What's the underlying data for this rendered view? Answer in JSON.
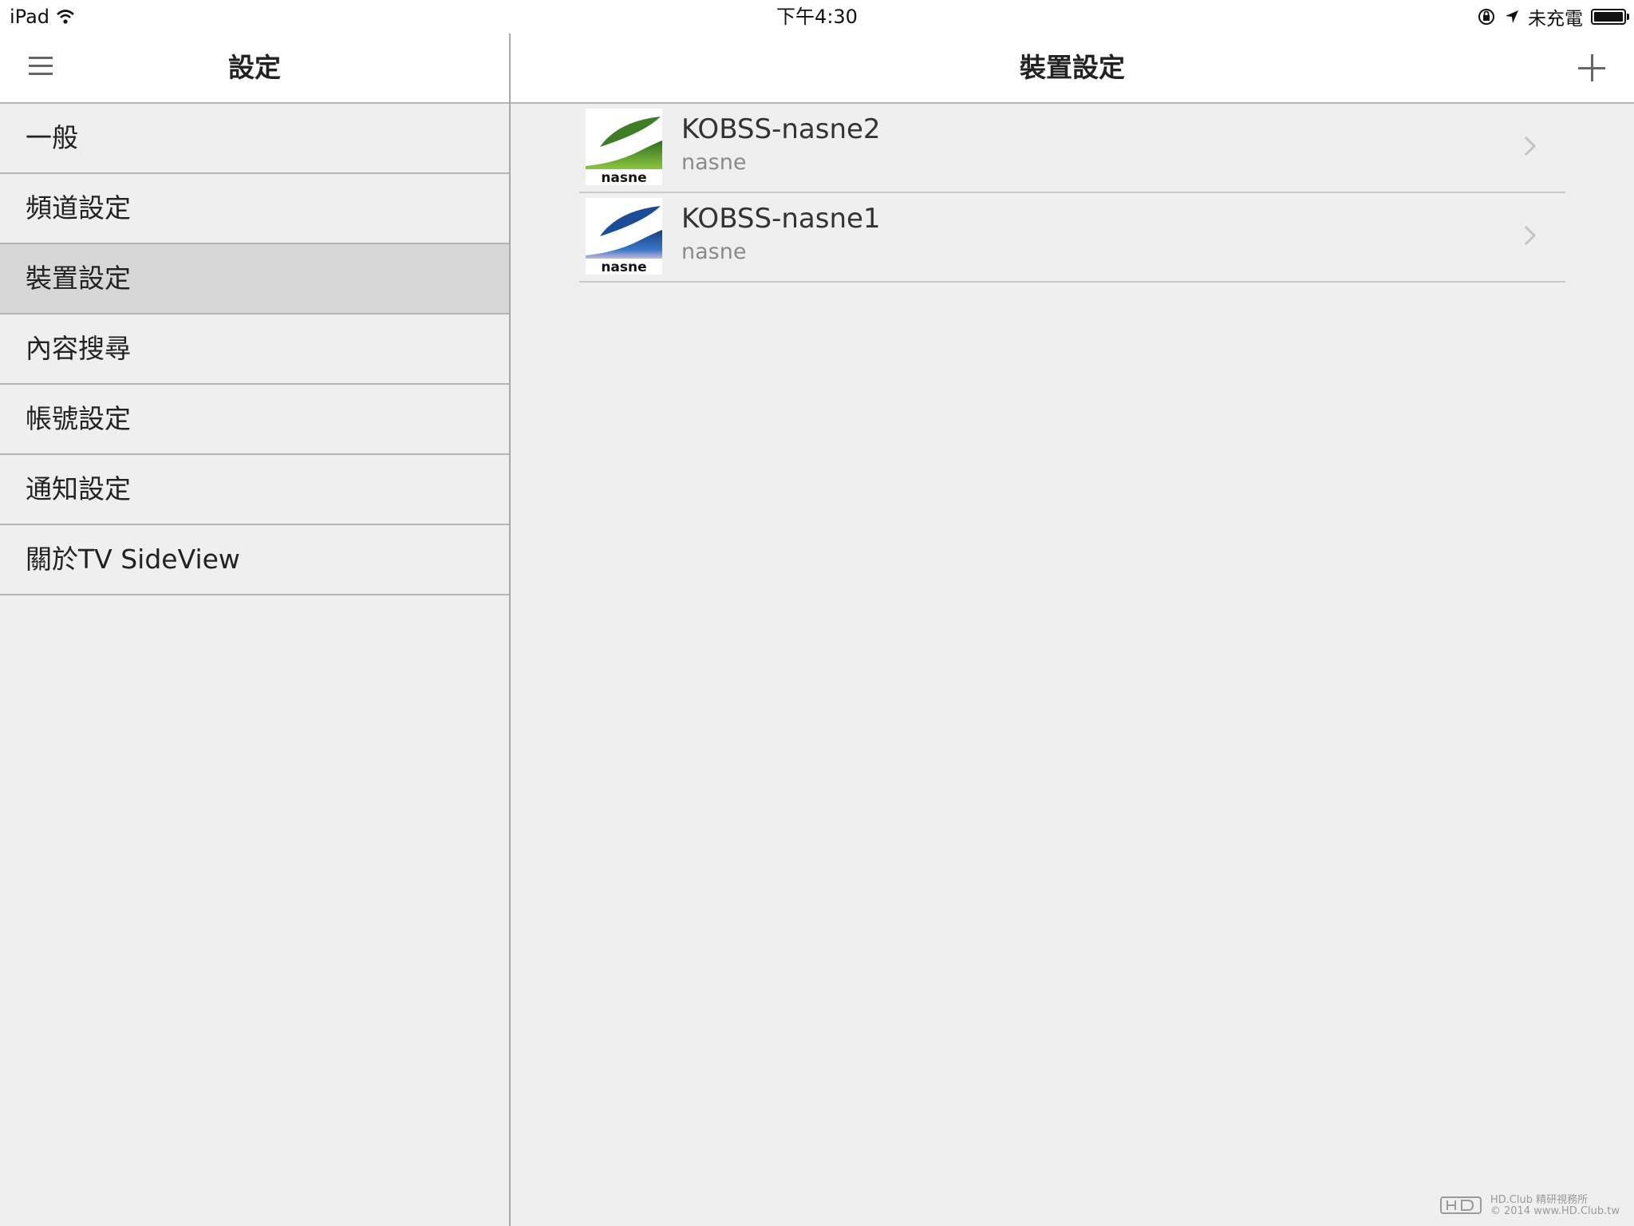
{
  "status_bar": {
    "device": "iPad",
    "time": "下午4:30",
    "charging_status": "未充電",
    "icons": [
      "wifi-icon",
      "rotation-lock-icon",
      "location-arrow-icon",
      "battery-icon"
    ]
  },
  "left_pane": {
    "title": "設定",
    "menu_icon": "menu-icon",
    "items": [
      {
        "label": "一般",
        "selected": false
      },
      {
        "label": "頻道設定",
        "selected": false
      },
      {
        "label": "裝置設定",
        "selected": true
      },
      {
        "label": "內容搜尋",
        "selected": false
      },
      {
        "label": "帳號設定",
        "selected": false
      },
      {
        "label": "通知設定",
        "selected": false
      },
      {
        "label": "關於TV SideView",
        "selected": false
      }
    ]
  },
  "right_pane": {
    "title": "裝置設定",
    "add_icon": "plus-icon",
    "devices": [
      {
        "name": "KOBSS-nasne2",
        "model": "nasne",
        "logo_text": "nasne",
        "logo_color": "#4f9a2c"
      },
      {
        "name": "KOBSS-nasne1",
        "model": "nasne",
        "logo_text": "nasne",
        "logo_color": "#1f5aa6"
      }
    ]
  },
  "watermark": {
    "line1": "HD.Club 精研視務所",
    "line2": "© 2014 www.HD.Club.tw"
  },
  "colors": {
    "background": "#efefef",
    "selected_row": "#d7d7d7",
    "divider": "#b5b5b5",
    "secondary_text": "#8a8a8a"
  }
}
